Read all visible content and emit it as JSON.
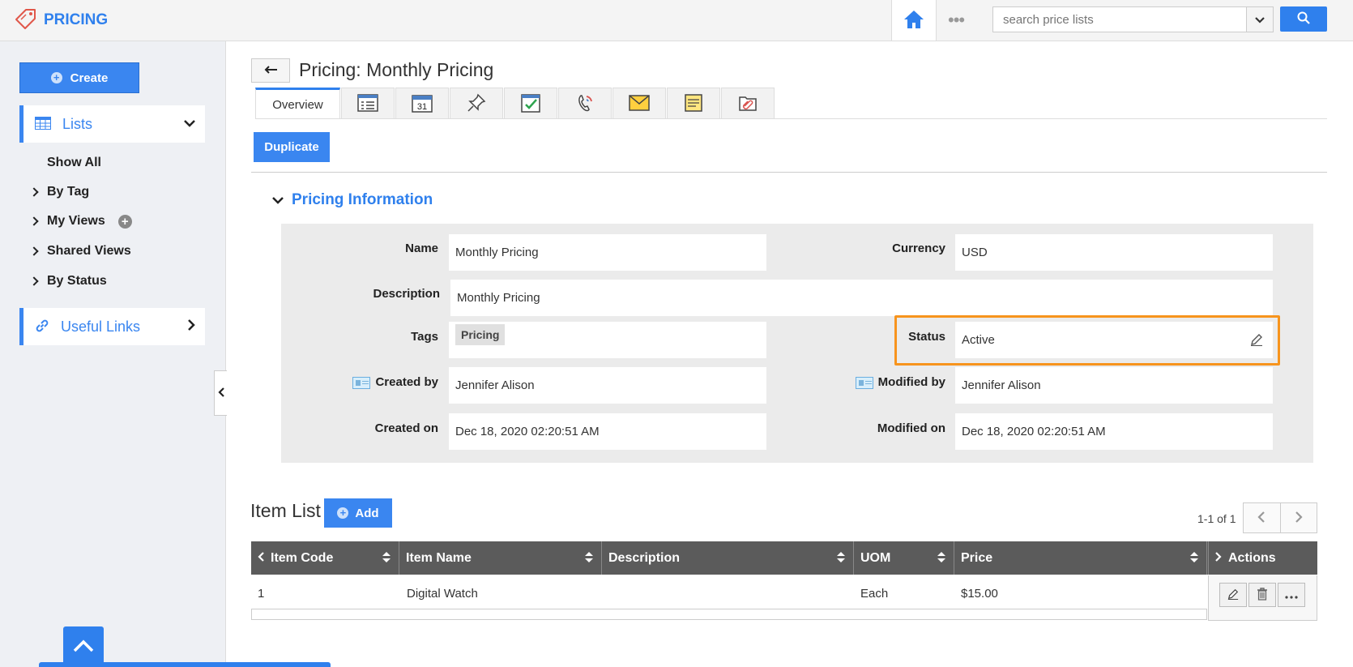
{
  "app": {
    "title": "PRICING"
  },
  "search": {
    "placeholder": "search price lists"
  },
  "topbar": {
    "more_label": "•••"
  },
  "sidebar": {
    "create_label": "Create",
    "lists_label": "Lists",
    "show_all": "Show All",
    "by_tag": "By Tag",
    "my_views": "My Views",
    "shared_views": "Shared Views",
    "by_status": "By Status",
    "useful_links": "Useful Links"
  },
  "page": {
    "title": "Pricing: Monthly Pricing",
    "overview_tab": "Overview",
    "tab_icons": [
      "details-form-icon",
      "calendar-icon",
      "pin-icon",
      "task-check-icon",
      "call-icon",
      "email-icon",
      "notes-icon",
      "attachment-icon"
    ],
    "calendar_day": "31",
    "duplicate_label": "Duplicate"
  },
  "pricing_info": {
    "section_title": "Pricing Information",
    "name_label": "Name",
    "name_value": "Monthly Pricing",
    "currency_label": "Currency",
    "currency_value": "USD",
    "description_label": "Description",
    "description_value": "Monthly Pricing",
    "tags_label": "Tags",
    "tag_value": "Pricing",
    "status_label": "Status",
    "status_value": "Active",
    "created_by_label": "Created by",
    "created_by_value": "Jennifer Alison",
    "modified_by_label": "Modified by",
    "modified_by_value": "Jennifer Alison",
    "created_on_label": "Created on",
    "created_on_value": "Dec 18, 2020 02:20:51 AM",
    "modified_on_label": "Modified on",
    "modified_on_value": "Dec 18, 2020 02:20:51 AM"
  },
  "item_list": {
    "title": "Item List",
    "add_label": "Add",
    "pager_text": "1-1 of 1",
    "columns": [
      "Item Code",
      "Item Name",
      "Description",
      "UOM",
      "Price",
      "Actions"
    ],
    "rows": [
      {
        "item_code": "1",
        "item_name": "Digital Watch",
        "description": "",
        "uom": "Each",
        "price": "$15.00"
      }
    ]
  },
  "colors": {
    "accent": "#2f80ed",
    "highlight": "#f7941d",
    "grid_header": "#5b5b5b"
  }
}
